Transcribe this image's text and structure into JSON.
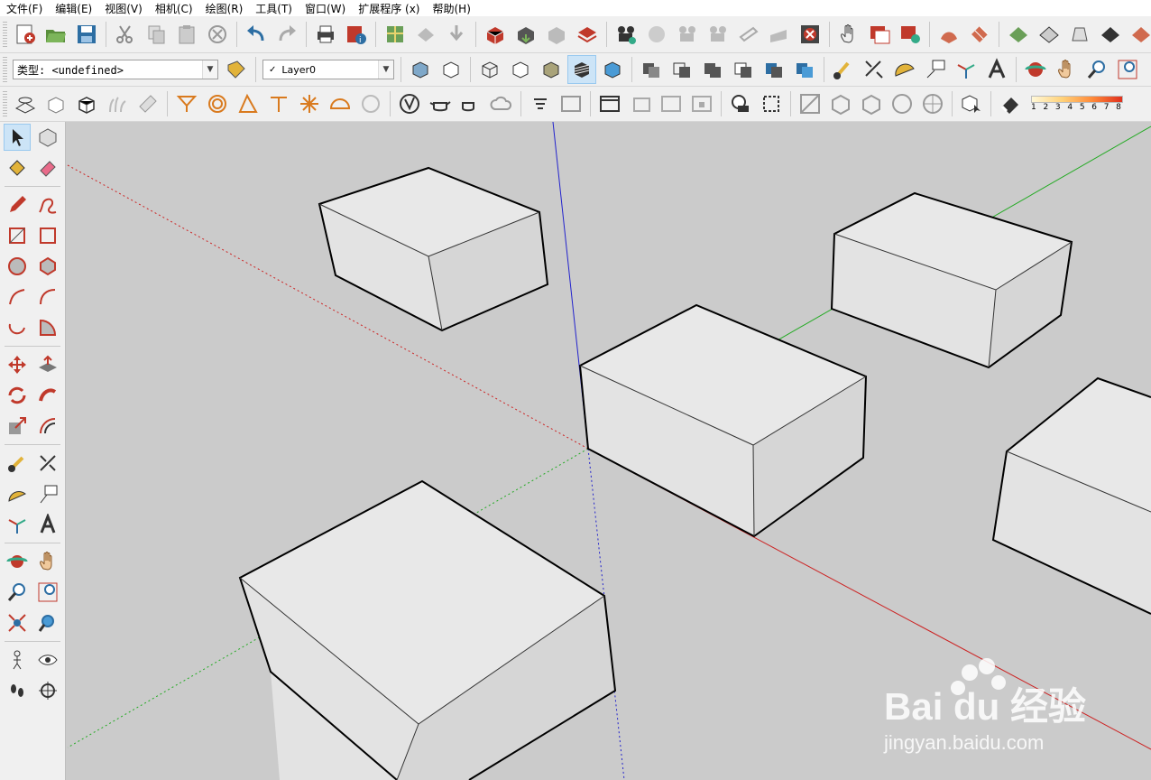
{
  "menu": [
    "文件(F)",
    "编辑(E)",
    "视图(V)",
    "相机(C)",
    "绘图(R)",
    "工具(T)",
    "窗口(W)",
    "扩展程序 (x)",
    "帮助(H)"
  ],
  "toolbar2": {
    "type_label": "类型: <undefined>",
    "layer_check": "✓",
    "layer_name": "Layer0"
  },
  "scale_numbers": [
    "1",
    "2",
    "3",
    "4",
    "5",
    "6",
    "7",
    "8"
  ],
  "watermark": {
    "logo": "Bai du 经验",
    "url": "jingyan.baidu.com"
  },
  "colors": {
    "viewport_bg": "#cbcbcb",
    "red_axis": "#cc2222",
    "green_axis": "#22aa22",
    "blue_axis": "#2222cc",
    "box_face": "#e6e6e6"
  }
}
